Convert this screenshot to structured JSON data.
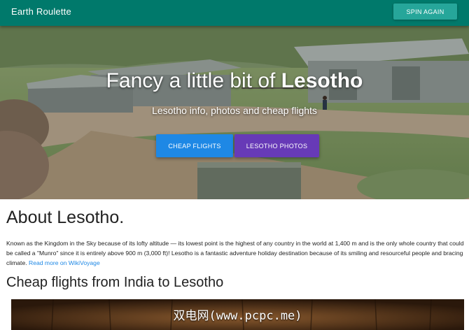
{
  "appbar": {
    "title": "Earth Roulette",
    "spin_label": "SPIN AGAIN",
    "color": "#00796b"
  },
  "hero": {
    "title_prefix": "Fancy a little bit of ",
    "country": "Lesotho",
    "subtitle": "Lesotho info, photos and cheap flights",
    "flights_button": "CHEAP FLIGHTS",
    "photos_button": "LESOTHO PHOTOS",
    "flights_button_color": "#1e88e5",
    "photos_button_color": "#673ab7"
  },
  "about": {
    "heading": "About Lesotho.",
    "body": "Known as the Kingdom in the Sky because of its lofty altitude — its lowest point is the highest of any country in the world at 1,400 m and is the only whole country that could be called a \"Munro\" since it is entirely above 900 m (3,000 ft)! Lesotho is a fantastic adventure holiday destination because of its smiling and resourceful people and bracing climate. ",
    "link": "Read more on WikiVoyage"
  },
  "flights": {
    "heading": "Cheap flights from India to Lesotho"
  },
  "photo": {
    "watermark": "双电网(www.pcpc.me)"
  }
}
